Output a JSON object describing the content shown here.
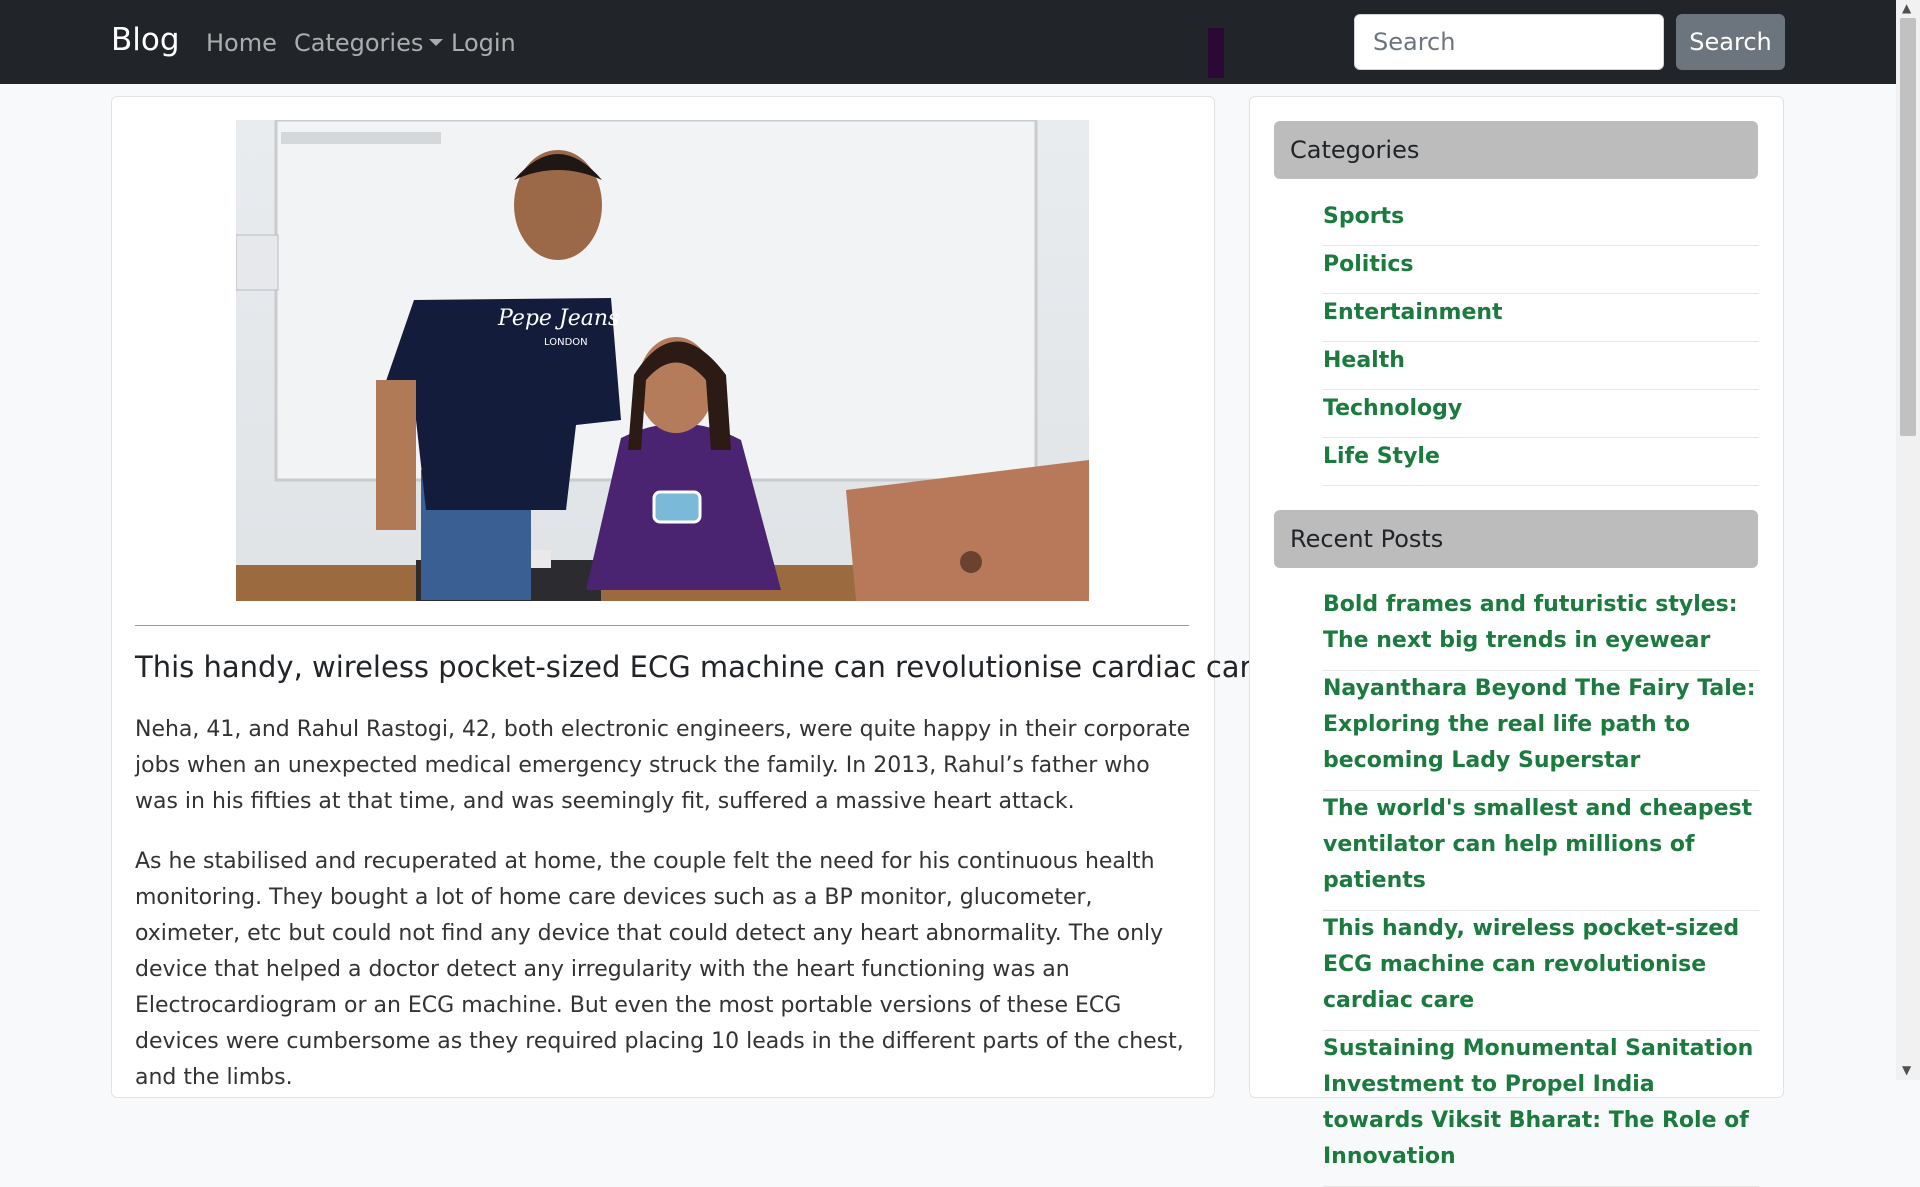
{
  "navbar": {
    "brand": "Blog",
    "links": {
      "home": "Home",
      "categories": "Categories",
      "login": "Login"
    },
    "search_placeholder": "Search",
    "search_button": "Search"
  },
  "article": {
    "title": "This handy, wireless pocket-sized ECG machine can revolutionise cardiac care",
    "paragraphs": [
      "Neha, 41, and Rahul Rastogi, 42, both electronic engineers, were quite happy in their corporate jobs when an unexpected medical emergency struck the family. In 2013, Rahul’s father who was in his fifties at that time, and was seemingly fit, suffered a massive heart attack.",
      "As he stabilised and recuperated at home,  the couple felt the need for his continuous health monitoring. They bought a lot of home care devices such as a BP monitor, glucometer, oximeter, etc but could not find any device that could detect any heart abnormality. The only device that helped a doctor detect any irregularity with the heart functioning was an Electrocardiogram or an ECG machine. But even the most portable versions of these ECG devices were cumbersome as they required placing 10 leads in the different parts of the chest, and the limbs."
    ],
    "image_shirt_text_1": "Pepe Jeans",
    "image_shirt_text_2": "LONDON"
  },
  "sidebar": {
    "categories_title": "Categories",
    "categories": [
      "Sports",
      "Politics",
      "Entertainment",
      "Health",
      "Technology",
      "Life Style"
    ],
    "recent_title": "Recent Posts",
    "recent_posts": [
      "Bold frames and futuristic styles: The next big trends in eyewear",
      "Nayanthara Beyond The Fairy Tale: Exploring the real life path to becoming Lady Superstar",
      "The world's smallest and cheapest ventilator can help millions of patients",
      "This handy, wireless pocket-sized ECG machine can revolutionise cardiac care",
      "Sustaining Monumental Sanitation Investment to Propel India towards Viksit Bharat: The Role of Innovation"
    ]
  },
  "colors": {
    "navbar_bg": "#212529",
    "link_green": "#1b7a3e",
    "sidebar_header_bg": "#bcbcbc",
    "search_button_bg": "#6c757d"
  },
  "icons": {
    "dropdown": "caret-down-icon",
    "scroll_up": "arrow-up-icon",
    "scroll_down": "arrow-down-icon"
  }
}
